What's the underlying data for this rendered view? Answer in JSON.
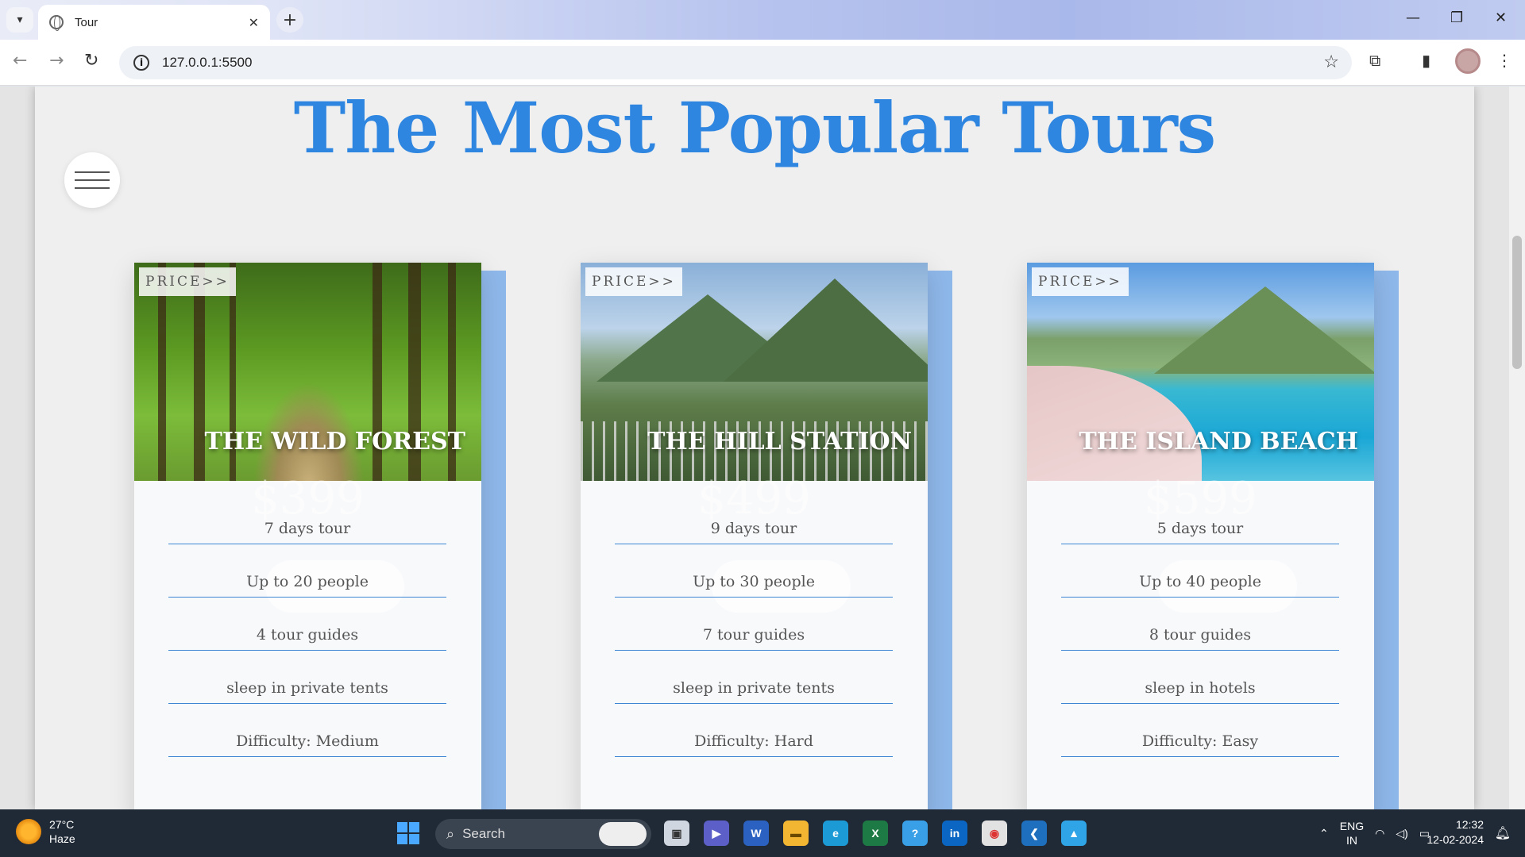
{
  "browser": {
    "tab_title": "Tour",
    "url": "127.0.0.1:5500",
    "tab_close": "✕",
    "new_tab": "+"
  },
  "page": {
    "heading": "The Most Popular Tours",
    "cards": [
      {
        "price_tag": "PRICE>>",
        "title": "THE WILD FOREST",
        "price": "$399",
        "features": [
          "7 days tour",
          "Up to 20 people",
          "4 tour guides",
          "sleep in private tents",
          "Difficulty: Medium"
        ]
      },
      {
        "price_tag": "PRICE>>",
        "title": "THE HILL STATION",
        "price": "$499",
        "features": [
          "9 days tour",
          "Up to 30 people",
          "7 tour guides",
          "sleep in private tents",
          "Difficulty: Hard"
        ]
      },
      {
        "price_tag": "PRICE>>",
        "title": "THE ISLAND BEACH",
        "price": "$599",
        "features": [
          "5 days tour",
          "Up to 40 people",
          "8 tour guides",
          "sleep in hotels",
          "Difficulty: Easy"
        ]
      }
    ]
  },
  "taskbar": {
    "temperature": "27°C",
    "weather": "Haze",
    "search": "Search",
    "language": "ENG",
    "region": "IN",
    "time": "12:32",
    "date": "12-02-2024"
  },
  "colors": {
    "accent": "#2f86e0",
    "card_back": "#8fb8ea"
  }
}
